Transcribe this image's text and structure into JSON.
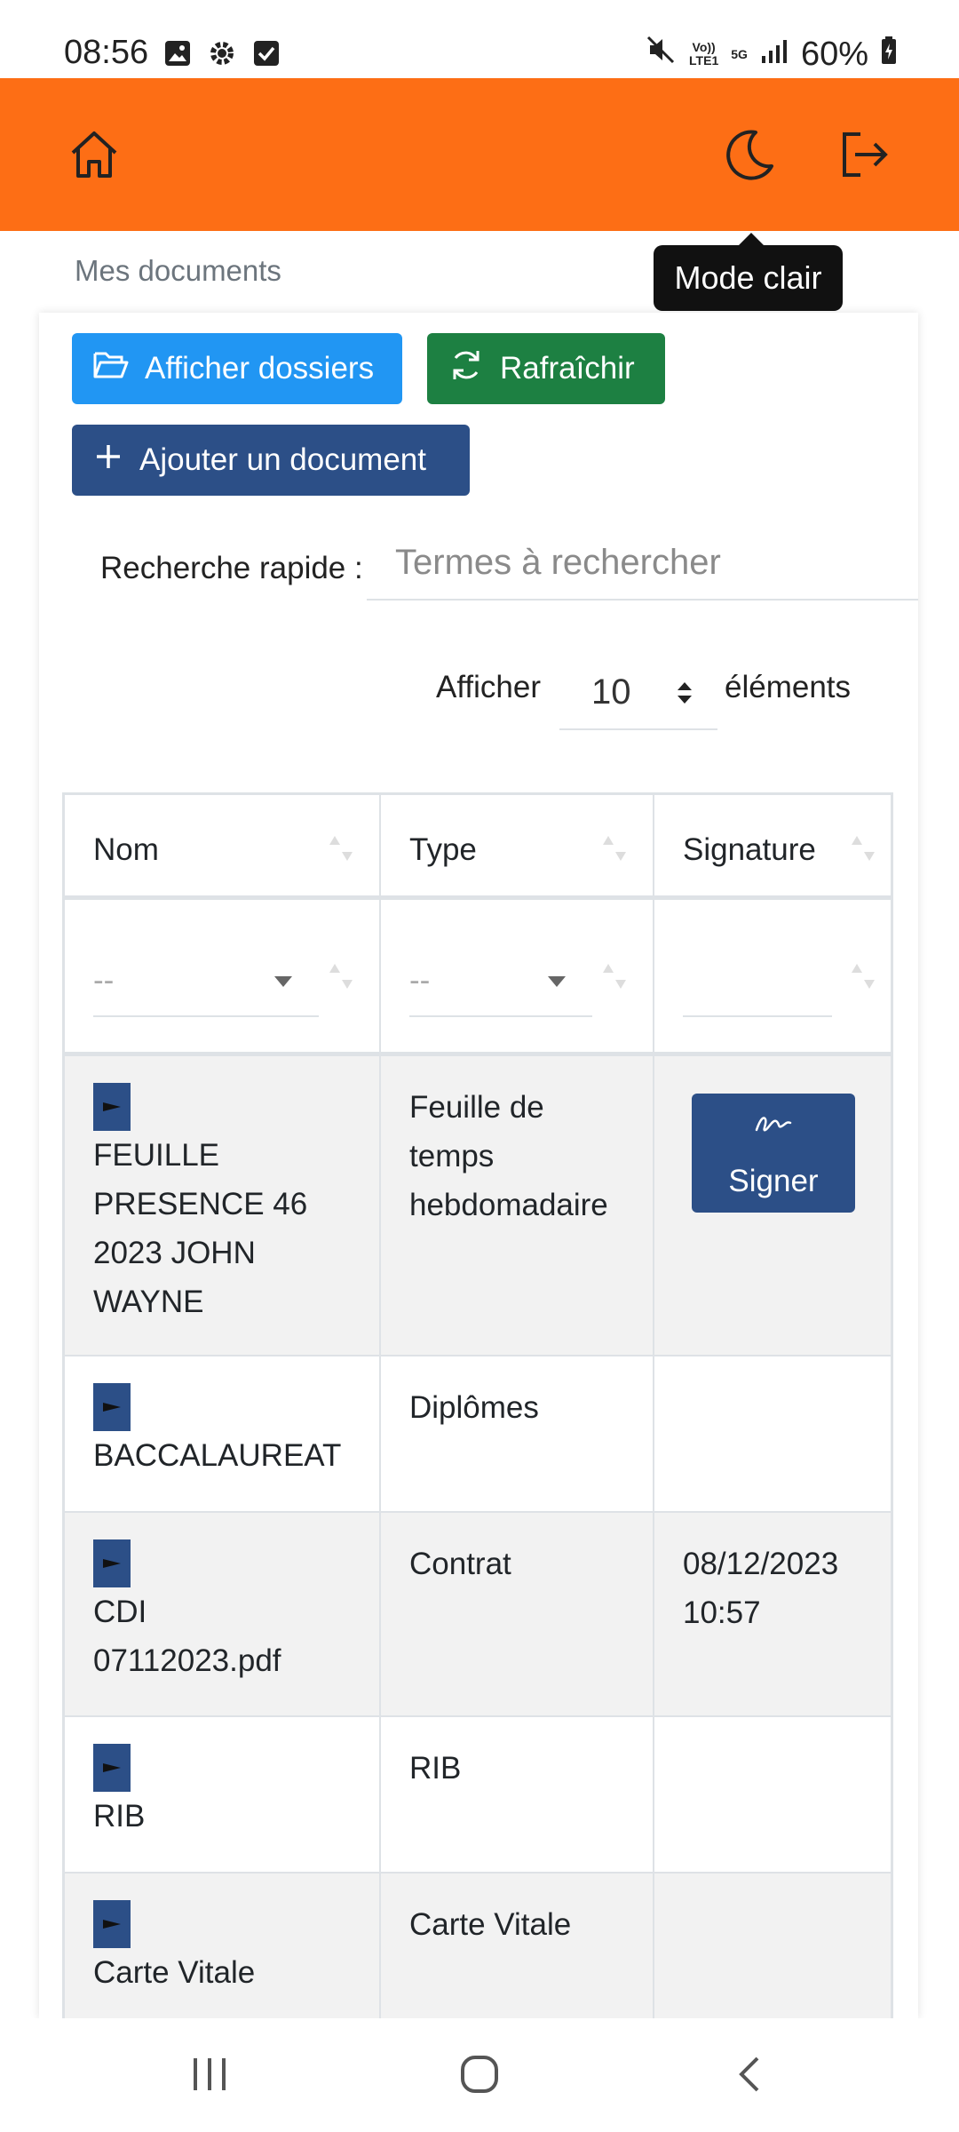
{
  "status_bar": {
    "time": "08:56",
    "network_top": "Vo))",
    "network_bottom": "LTE1",
    "network_5g": "5G",
    "battery": "60%"
  },
  "header": {
    "tooltip": "Mode clair"
  },
  "breadcrumb": "Mes documents",
  "toolbar": {
    "show_folders": "Afficher dossiers",
    "refresh": "Rafraîchir",
    "add_document": "Ajouter un document"
  },
  "search": {
    "label": "Recherche rapide :",
    "placeholder": "Termes à rechercher",
    "value": ""
  },
  "page_length": {
    "label_before": "Afficher",
    "value": "10",
    "label_after": "éléments"
  },
  "table": {
    "columns": [
      "Nom",
      "Type",
      "Signature"
    ],
    "filters": {
      "nom": "--",
      "type": "--",
      "signature": ""
    },
    "rows": [
      {
        "name": "FEUILLE PRESENCE 46 2023 JOHN WAYNE",
        "type": "Feuille de temps hebdomadaire",
        "signature": "",
        "sign_button": "Signer"
      },
      {
        "name": "BACCALAUREAT",
        "type": "Diplômes",
        "signature": ""
      },
      {
        "name": "CDI 07112023.pdf",
        "type": "Contrat",
        "signature": "08/12/2023 10:57"
      },
      {
        "name": "RIB",
        "type": "RIB",
        "signature": ""
      },
      {
        "name": "Carte Vitale",
        "type": "Carte Vitale",
        "signature": ""
      }
    ]
  },
  "icons": {
    "home": "home-icon",
    "theme": "moon-icon",
    "logout": "logout-icon",
    "folder": "folder-open-icon",
    "refresh": "refresh-icon",
    "add": "plus-icon",
    "file": "file-icon",
    "signature": "signature-icon"
  },
  "colors": {
    "header": "#fd6e15",
    "btn_folders": "#2196f3",
    "btn_refresh": "#1d8042",
    "btn_primary": "#2c4f87"
  }
}
